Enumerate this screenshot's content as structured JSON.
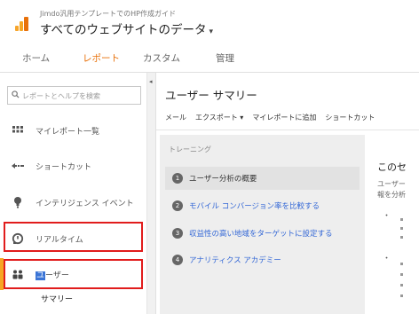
{
  "header": {
    "account": "Jimdo汎用テンプレートでのHP作成ガイド",
    "property": "すべてのウェブサイトのデータ",
    "caret": "▾"
  },
  "nav": {
    "tabs": [
      {
        "label": "ホーム"
      },
      {
        "label": "レポート"
      },
      {
        "label": "カスタム"
      },
      {
        "label": "管理"
      }
    ],
    "active_tab": "レポート",
    "accent": "#e8710a"
  },
  "sidebar": {
    "search_placeholder": "レポートとヘルプを検索",
    "collapse_glyph": "◂",
    "items": [
      {
        "label": "マイレポート一覧",
        "icon": "grid-icon"
      },
      {
        "label": "ショートカット",
        "icon": "shortcut-arrow-icon"
      },
      {
        "label": "インテリジェンス イベント",
        "icon": "lightbulb-icon"
      },
      {
        "label": "リアルタイム",
        "icon": "clock-icon"
      },
      {
        "label_highlight": "ユ",
        "label_rest": "ーザー",
        "icon": "users-icon"
      }
    ],
    "subitem": "サマリー",
    "highlight_color": "#e11c1c",
    "active_color": "#f6a623"
  },
  "main": {
    "title": "ユーザー サマリー",
    "toolbar": {
      "email": "メール",
      "export": "エクスポート ▾",
      "add_to_dashboard": "マイレポートに追加",
      "shortcut": "ショートカット"
    },
    "training": {
      "heading": "トレーニング",
      "items": [
        {
          "num": "1",
          "label": "ユーザー分析の概要"
        },
        {
          "num": "2",
          "label": "モバイル コンバージョン率を比較する"
        },
        {
          "num": "3",
          "label": "収益性の高い地域をターゲットに設定する"
        },
        {
          "num": "4",
          "label": "アナリティクス アカデミー"
        }
      ]
    },
    "content": {
      "title": "このセ",
      "line1": "ユーザー",
      "line2": "報を分析",
      "b1": "・",
      "b2": "・"
    }
  }
}
